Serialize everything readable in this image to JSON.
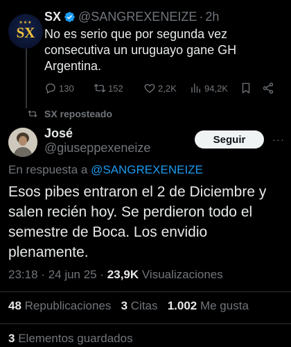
{
  "tweet1": {
    "name": "SX",
    "handle": "@SANGREXENEIZE",
    "separator": "·",
    "time": "2h",
    "text": "No es serio que por segunda vez consecutiva un uruguayo gane GH Argentina.",
    "avatar_mono": "SX",
    "avatar_stars": "★★★",
    "replies": "130",
    "reposts": "152",
    "likes": "2,2K",
    "views": "94,2K"
  },
  "repost_label": "SX reposteado",
  "tweet2": {
    "name": "José",
    "handle": "@giuseppexeneize",
    "follow_label": "Seguir",
    "more": "···",
    "reply_prefix": "En respuesta a",
    "reply_mention": "@SANGREXENEIZE",
    "text": "Esos pibes entraron el 2 de Diciembre y salen recién hoy. Se perdieron todo el semestre de Boca. Los envidio plenamente.",
    "time": "23:18",
    "date": "24 jun 25",
    "dot": "·",
    "views_count": "23,9K",
    "views_label": "Visualizaciones",
    "reposts_count": "48",
    "reposts_label": "Republicaciones",
    "quotes_count": "3",
    "quotes_label": "Citas",
    "likes_count": "1.002",
    "likes_label": "Me gusta",
    "saved_count": "3",
    "saved_label": "Elementos guardados"
  },
  "colors": {
    "background": "#000000",
    "text": "#e7e9ea",
    "muted": "#71767b",
    "accent": "#1d9bf0",
    "divider": "#2f3336"
  },
  "icons": [
    "verified-badge-icon",
    "reply-icon",
    "repost-icon",
    "like-icon",
    "views-icon",
    "bookmark-icon",
    "share-icon",
    "repost-small-icon",
    "more-icon"
  ]
}
